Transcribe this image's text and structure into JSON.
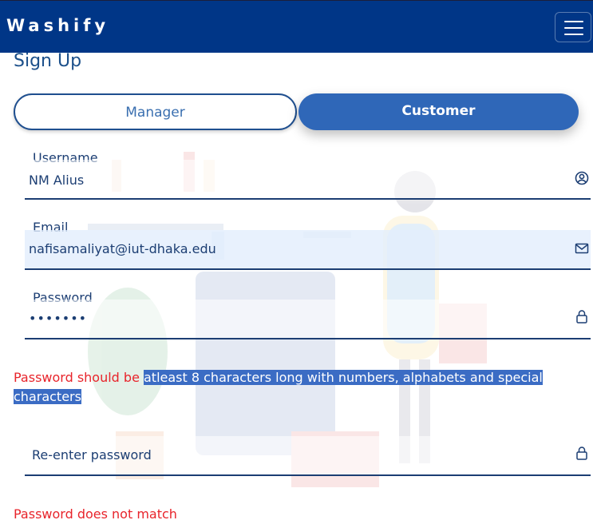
{
  "app": {
    "brand": "Washify"
  },
  "page": {
    "title": "Sign Up"
  },
  "roles": {
    "manager_label": "Manager",
    "customer_label": "Customer"
  },
  "form": {
    "username": {
      "label": "Username",
      "value": "NM Alius"
    },
    "email": {
      "label": "Email",
      "value": "nafisamaliyat@iut-dhaka.edu"
    },
    "password": {
      "label": "Password",
      "value": "•••••••"
    },
    "password_error_prefix": "Password should be ",
    "password_error_highlight_1": "atleast 8 characters long with numbers, alphabets and special",
    "password_error_highlight_2": "characters",
    "reenter": {
      "placeholder": "Re-enter password"
    },
    "match_error": "Password does not match"
  },
  "icons": {
    "menu": "hamburger-icon",
    "username": "user-circle-icon",
    "email": "envelope-icon",
    "password": "lock-icon"
  },
  "colors": {
    "navbar": "#003687",
    "primary": "#2f67b8",
    "text": "#1c3e73",
    "error": "#e8242b",
    "highlight": "#3b6cc4"
  }
}
